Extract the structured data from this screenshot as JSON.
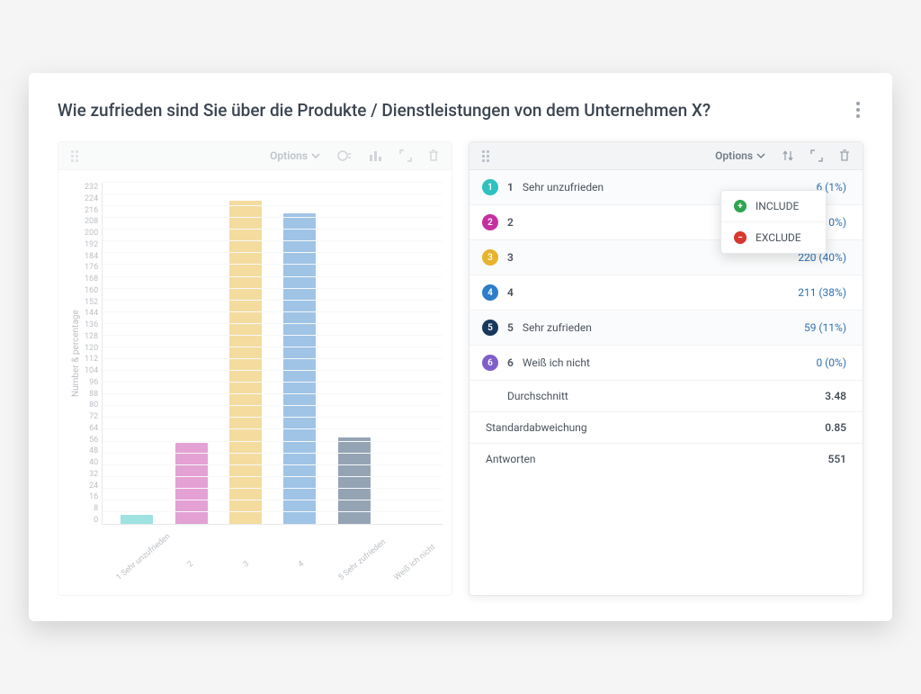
{
  "header": {
    "title": "Wie zufrieden sind Sie über die Produkte / Dienstleistungen von dem Unternehmen X?"
  },
  "toolbar": {
    "options_label": "Options"
  },
  "menu": {
    "include": "INCLUDE",
    "exclude": "EXCLUDE"
  },
  "chart_data": {
    "type": "bar",
    "ylabel": "Number & percentage",
    "xlabel": "",
    "ylim": [
      0,
      232
    ],
    "y_ticks": [
      0,
      8,
      16,
      24,
      32,
      40,
      48,
      56,
      64,
      72,
      80,
      88,
      96,
      104,
      112,
      120,
      128,
      136,
      144,
      152,
      160,
      168,
      176,
      184,
      192,
      200,
      208,
      216,
      224,
      232
    ],
    "categories": [
      "1 Sehr unzufrieden",
      "2",
      "3",
      "4",
      "5 Sehr zufrieden",
      "Weiß ich nicht"
    ],
    "values": [
      6,
      55,
      220,
      211,
      59,
      0
    ],
    "colors": [
      "#2dc1c1",
      "#c530a1",
      "#e7b32b",
      "#2d7dc9",
      "#17375b",
      "#805fc9"
    ]
  },
  "table": {
    "rows": [
      {
        "n": "1",
        "label": "Sehr unzufrieden",
        "count": 6,
        "pct": "1%",
        "color": "#2dc1c1"
      },
      {
        "n": "2",
        "label": "",
        "count": 55,
        "pct": "10%",
        "color": "#c530a1"
      },
      {
        "n": "3",
        "label": "",
        "count": 220,
        "pct": "40%",
        "color": "#e7b32b"
      },
      {
        "n": "4",
        "label": "",
        "count": 211,
        "pct": "38%",
        "color": "#2d7dc9"
      },
      {
        "n": "5",
        "label": "Sehr zufrieden",
        "count": 59,
        "pct": "11%",
        "color": "#17375b"
      },
      {
        "n": "6",
        "label": "Weiß ich nicht",
        "count": 0,
        "pct": "0%",
        "color": "#805fc9"
      }
    ],
    "stats": [
      {
        "key": "mean",
        "label": "Durchschnitt",
        "value": "3.48"
      },
      {
        "key": "stdev",
        "label": "Standardabweichung",
        "value": "0.85"
      },
      {
        "key": "n",
        "label": "Antworten",
        "value": "551"
      }
    ]
  }
}
